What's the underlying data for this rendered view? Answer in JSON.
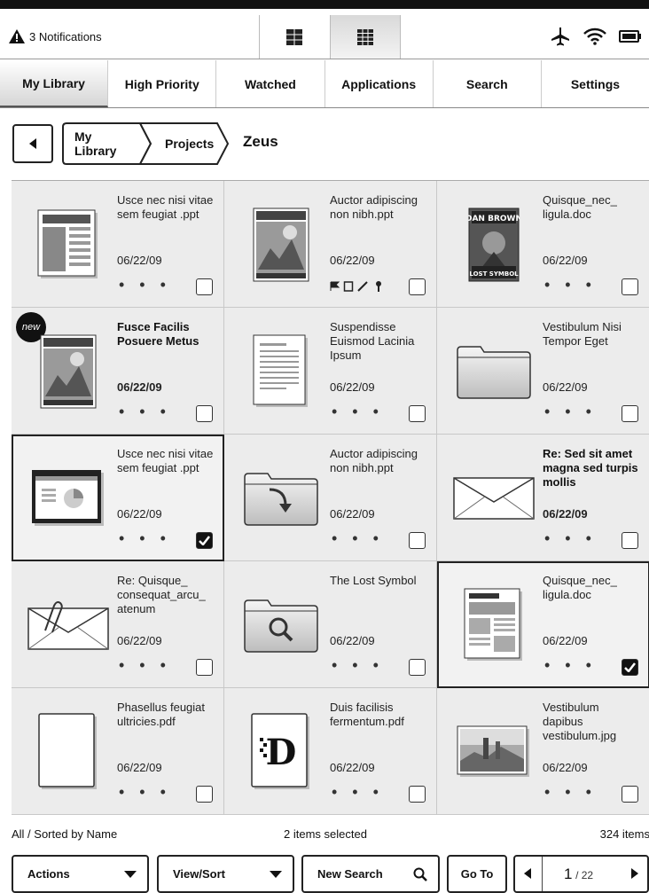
{
  "status": {
    "notifications": "3 Notifications"
  },
  "tabs": [
    {
      "label": "My Library"
    },
    {
      "label": "High Priority"
    },
    {
      "label": "Watched"
    },
    {
      "label": "Applications"
    },
    {
      "label": "Search"
    },
    {
      "label": "Settings"
    }
  ],
  "breadcrumb": {
    "items": [
      "My Library",
      "Projects"
    ],
    "current": "Zeus"
  },
  "items": [
    {
      "title": "Usce nec nisi vitae sem feugiat .ppt",
      "date": "06/22/09",
      "thumb": "presentation-cover-icon",
      "checked": false
    },
    {
      "title": "Auctor adipiscing non nibh.ppt",
      "date": "06/22/09",
      "thumb": "magazine-cover-icon",
      "checked": false
    },
    {
      "title": "Quisque_nec_ ligula.doc",
      "date": "06/22/09",
      "thumb": "book-cover-icon",
      "checked": false
    },
    {
      "title": "Fusce Facilis Posuere Metus",
      "date": "06/22/09",
      "thumb": "magazine-cover-icon",
      "badge": "new",
      "checked": false
    },
    {
      "title": "Suspendisse Euismod Lacinia Ipsum",
      "date": "06/22/09",
      "thumb": "document-icon",
      "checked": false
    },
    {
      "title": "Vestibulum Nisi Tempor Eget",
      "date": "06/22/09",
      "thumb": "folder-icon",
      "checked": false
    },
    {
      "title": "Usce nec nisi vitae sem feugiat .ppt",
      "date": "06/22/09",
      "thumb": "slide-icon",
      "checked": true
    },
    {
      "title": "Auctor adipiscing non nibh.ppt",
      "date": "06/22/09",
      "thumb": "folder-arrow-icon",
      "checked": false
    },
    {
      "title": "Re: Sed sit amet magna sed turpis mollis",
      "date": "06/22/09",
      "thumb": "envelope-icon",
      "checked": false
    },
    {
      "title": "Re: Quisque_ consequat_arcu_ atenum",
      "date": "06/22/09",
      "thumb": "envelope-attachment-icon",
      "checked": false
    },
    {
      "title": "The Lost Symbol",
      "date": "06/22/09",
      "thumb": "folder-search-icon",
      "checked": false
    },
    {
      "title": "Quisque_nec_ ligula.doc",
      "date": "06/22/09",
      "thumb": "newspaper-icon",
      "checked": true
    },
    {
      "title": "Phasellus feugiat ultricies.pdf",
      "date": "06/22/09",
      "thumb": "blank-page-icon",
      "checked": false
    },
    {
      "title": "Duis facilisis fermentum.pdf",
      "date": "06/22/09",
      "thumb": "pdf-icon",
      "checked": false
    },
    {
      "title": "Vestibulum dapibus vestibulum.jpg",
      "date": "06/22/09",
      "thumb": "photo-icon",
      "checked": false
    }
  ],
  "more": "• • •",
  "footer": {
    "sort": "All / Sorted by Name",
    "selected": "2 items selected",
    "count": "324 items"
  },
  "buttons": {
    "actions": "Actions",
    "view_sort": "View/Sort",
    "new_search": "New Search",
    "go_to": "Go To",
    "page_current": "1",
    "page_total": "/ 22"
  }
}
